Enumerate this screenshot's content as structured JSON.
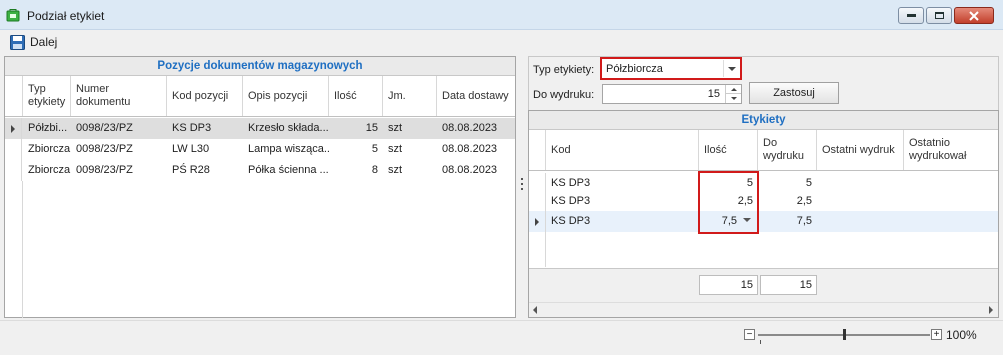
{
  "window": {
    "title": "Podział etykiet"
  },
  "toolbar": {
    "next_label": "Dalej"
  },
  "left_panel": {
    "caption": "Pozycje dokumentów magazynowych",
    "columns": [
      "Typ etykiety",
      "Numer dokumentu",
      "Kod pozycji",
      "Opis pozycji",
      "Ilość",
      "Jm.",
      "Data dostawy"
    ],
    "rows": [
      {
        "typ": "Półzbi...",
        "numer": "0098/23/PZ",
        "kod": "KS DP3",
        "opis": "Krzesło składa...",
        "ilosc": "15",
        "jm": "szt",
        "data": "08.08.2023"
      },
      {
        "typ": "Zbiorcza",
        "numer": "0098/23/PZ",
        "kod": "LW L30",
        "opis": "Lampa wisząca...",
        "ilosc": "5",
        "jm": "szt",
        "data": "08.08.2023"
      },
      {
        "typ": "Zbiorcza",
        "numer": "0098/23/PZ",
        "kod": "PŚ R28",
        "opis": "Półka ścienna ...",
        "ilosc": "8",
        "jm": "szt",
        "data": "08.08.2023"
      }
    ]
  },
  "right_panel": {
    "type_label": "Typ etykiety:",
    "type_value": "Półzbiorcza",
    "print_label": "Do wydruku:",
    "print_value": "15",
    "apply_label": "Zastosuj",
    "caption": "Etykiety",
    "columns": [
      "Kod",
      "Ilość",
      "Do wydruku",
      "Ostatni wydruk",
      "Ostatnio wydrukował"
    ],
    "rows": [
      {
        "kod": "KS DP3",
        "ilosc": "5",
        "do_wydruku": "5"
      },
      {
        "kod": "KS DP3",
        "ilosc": "2,5",
        "do_wydruku": "2,5"
      },
      {
        "kod": "KS DP3",
        "ilosc": "7,5",
        "do_wydruku": "7,5"
      }
    ],
    "totals": {
      "ilosc": "15",
      "do_wydruku": "15"
    }
  },
  "zoom": {
    "value": "100%"
  },
  "colors": {
    "caption_blue": "#1f6fc2",
    "highlight_red": "#d11a1a"
  }
}
